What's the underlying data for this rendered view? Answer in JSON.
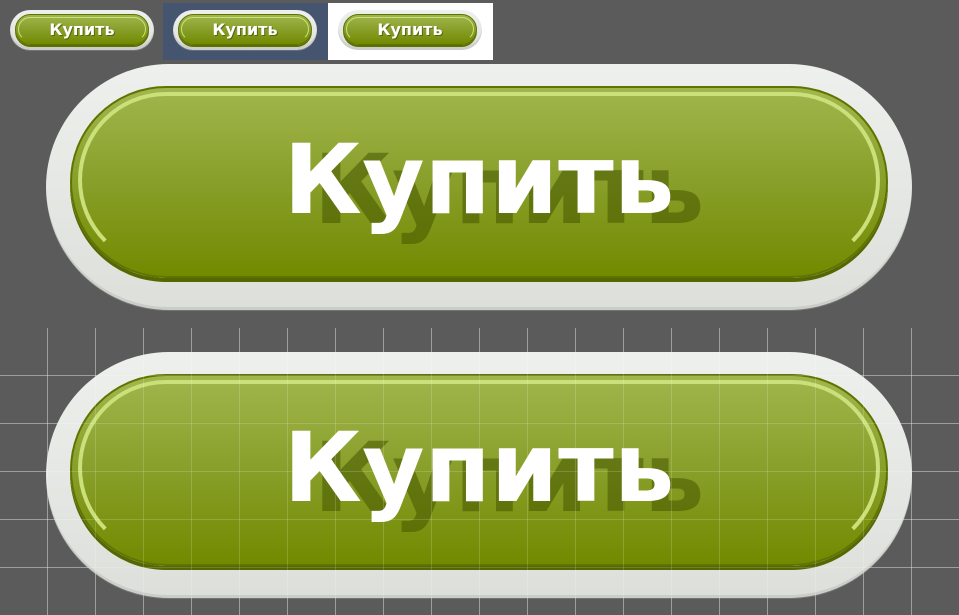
{
  "buttons": {
    "small_plain_label": "Купить",
    "small_blue_label": "Купить",
    "small_white_label": "Купить",
    "large_top_label": "Купить",
    "large_bottom_label": "Купить"
  },
  "colors": {
    "background": "#5b5b5b",
    "blue_panel": "#45546f",
    "white_panel": "#ffffff",
    "button_green_top": "#a1b64c",
    "button_green_bottom": "#728a00",
    "button_frame": "#e3e5e1"
  }
}
